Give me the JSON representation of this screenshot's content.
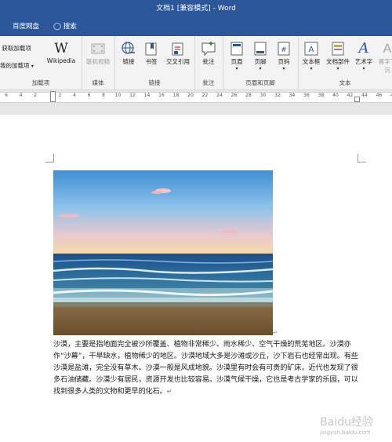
{
  "window": {
    "title": "文档1 [兼容模式] - Word"
  },
  "tabs": [
    "百度网盘",
    "搜索"
  ],
  "ribbon": {
    "addins": {
      "label": "加载项",
      "get_addins": "获取加载项",
      "my_addins": "我的加载项",
      "wikipedia": "Wikipedia"
    },
    "media": {
      "label": "媒体",
      "online_video": "联机视频"
    },
    "links": {
      "label": "链接",
      "link": "链接",
      "bookmark": "书签",
      "crossref": "交叉引用"
    },
    "comments": {
      "label": "批注",
      "comment": "批注"
    },
    "header_footer": {
      "label": "页眉和页脚",
      "header": "页眉",
      "footer": "页脚",
      "page_number": "页码"
    },
    "text": {
      "label": "文本",
      "textbox": "文本框",
      "quick_parts": "文档部件",
      "wordart": "艺术字",
      "dropcap": "首字下沉"
    }
  },
  "ruler": {
    "ticks": [
      "6",
      "4",
      "2",
      "2",
      "4",
      "6",
      "8",
      "10",
      "12",
      "14",
      "16",
      "18",
      "20",
      "22",
      "24",
      "26",
      "28",
      "30",
      "32",
      "34",
      "36",
      "38",
      "40",
      "42",
      "44",
      "46",
      "48"
    ]
  },
  "document": {
    "paragraph": "沙漠，主要是指地面完全被沙所覆盖、植物非常稀少、雨水稀少、空气干燥的荒芜地区。沙漠亦作“沙幕”，干旱缺水，植物稀少的地区。沙漠地域大多是沙滩或沙丘，沙下岩石也经常出现。有些沙漠是盐滩，完全没有草木。沙漠一般是风成地貌。沙漠里有时会有可贵的矿床，近代也发现了很多石油储藏。沙漠少有居民，资源开发也比较容易。沙漠气候干燥，它也是考古学家的乐园，可以找到很多人类的文物和更早的化石。",
    "para_mark": "↵",
    "image_mark": "↵"
  },
  "watermark": {
    "brand": "Baidu经验",
    "url": "jingyan.baidu.com"
  },
  "colors": {
    "accent": "#2b579a",
    "ribbon_bg": "#f3f3f3"
  }
}
